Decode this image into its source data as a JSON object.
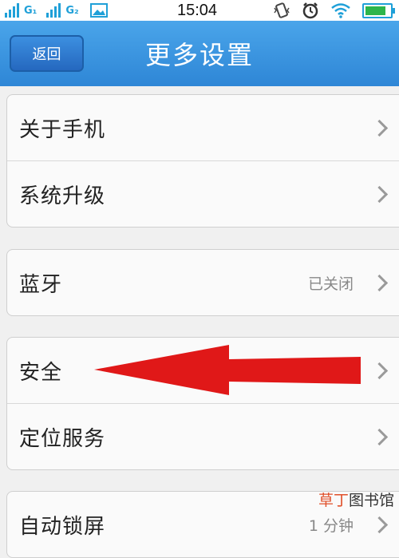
{
  "status_bar": {
    "net1": "G₁",
    "net2": "G₂",
    "time": "15:04",
    "icons": [
      "signal-icon",
      "signal-icon",
      "image-icon",
      "vibrate-icon",
      "alarm-icon",
      "wifi-icon",
      "battery-icon"
    ],
    "accent_color": "#1fa0d8",
    "battery_level": 0.9
  },
  "header": {
    "back_label": "返回",
    "title": "更多设置",
    "bg_color": "#3a95e0"
  },
  "groups": [
    {
      "items": [
        {
          "label": "关于手机"
        },
        {
          "label": "系统升级"
        }
      ]
    },
    {
      "items": [
        {
          "label": "蓝牙",
          "value": "已关闭"
        }
      ]
    },
    {
      "items": [
        {
          "label": "安全"
        },
        {
          "label": "定位服务"
        }
      ]
    },
    {
      "items": [
        {
          "label": "自动锁屏",
          "value": "1 分钟"
        }
      ]
    }
  ],
  "annotation": {
    "arrow_color": "#e01818",
    "points_to": "安全"
  },
  "watermark": {
    "part1": "草丁",
    "part2": "图书馆"
  }
}
